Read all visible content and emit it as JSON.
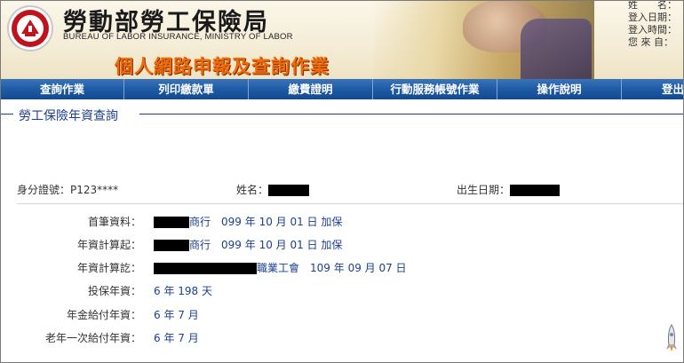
{
  "banner": {
    "org_name": "勞動部勞工保險局",
    "org_en": "BUREAU OF LABOR INSURANCE, MINISTRY OF LABOR",
    "service_title": "個人網路申報及查詢作業",
    "user_info_labels": [
      "姓　　名：",
      "登入日期：",
      "登入時間：",
      "您 來 自："
    ]
  },
  "nav": {
    "items": [
      "查詢作業",
      "列印繳款單",
      "繳費證明",
      "行動服務帳號作業",
      "操作說明",
      "登出"
    ]
  },
  "section": {
    "title": "勞工保險年資查詢"
  },
  "person": {
    "id_label": "身分證號：",
    "id_value": "P123****",
    "name_label": "姓名：",
    "dob_label": "出生日期："
  },
  "details": {
    "first_record": {
      "label": "首筆資料：",
      "suffix": "商行",
      "date": "099 年 10 月 01 日 加保"
    },
    "calc_start": {
      "label": "年資計算起：",
      "suffix": "商行",
      "date": "099 年 10 月 01 日 加保"
    },
    "calc_end": {
      "label": "年資計算訖：",
      "suffix": "職業工會",
      "date": "109 年 09 月 07 日"
    },
    "insured_years": {
      "label": "投保年資：",
      "value": "6 年 198 天"
    },
    "pension_years": {
      "label": "年金給付年資：",
      "value": "6 年 7 月"
    },
    "lump_sum_years": {
      "label": "老年一次給付年資：",
      "value": "6 年 7 月"
    }
  },
  "colors": {
    "nav_bg": "#1e5aa5",
    "section_blue": "#1b3f8f",
    "title_orange": "#ee6a0c"
  }
}
